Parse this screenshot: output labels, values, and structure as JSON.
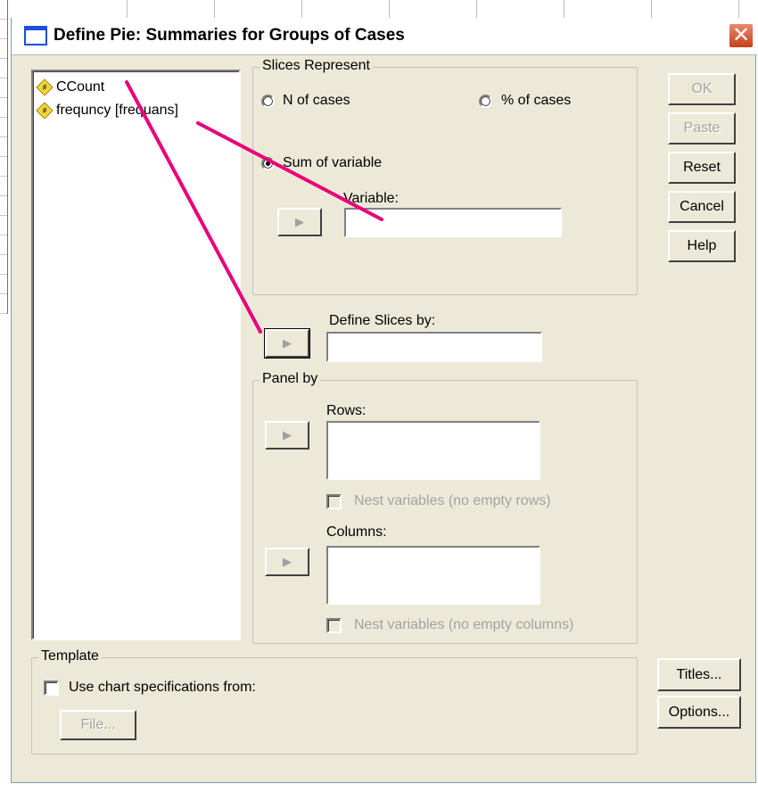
{
  "window": {
    "title": "Define Pie: Summaries for Groups of Cases"
  },
  "variables": [
    {
      "label": "CCount",
      "icon": "numeric-variable-icon"
    },
    {
      "label": "frequncy [frequans]",
      "icon": "numeric-variable-icon"
    }
  ],
  "slices_represent": {
    "group_label": "Slices Represent",
    "n_of_cases": "N of cases",
    "pct_of_cases": "% of cases",
    "sum_of_variable": "Sum of variable",
    "selected": "sum_of_variable",
    "variable_label": "Variable:",
    "variable_value": ""
  },
  "define_slices": {
    "label": "Define Slices by:",
    "value": ""
  },
  "panel_by": {
    "group_label": "Panel by",
    "rows_label": "Rows:",
    "nest_rows": "Nest variables (no empty rows)",
    "columns_label": "Columns:",
    "nest_columns": "Nest variables (no empty columns)"
  },
  "template": {
    "group_label": "Template",
    "use_spec": "Use chart specifications from:",
    "file_button": "File..."
  },
  "buttons": {
    "ok": "OK",
    "paste": "Paste",
    "reset": "Reset",
    "cancel": "Cancel",
    "help": "Help",
    "titles": "Titles...",
    "options": "Options..."
  },
  "colors": {
    "annotation": "#e8007a",
    "dialog_bg": "#ece9d8",
    "close_button": "#d9532b"
  }
}
